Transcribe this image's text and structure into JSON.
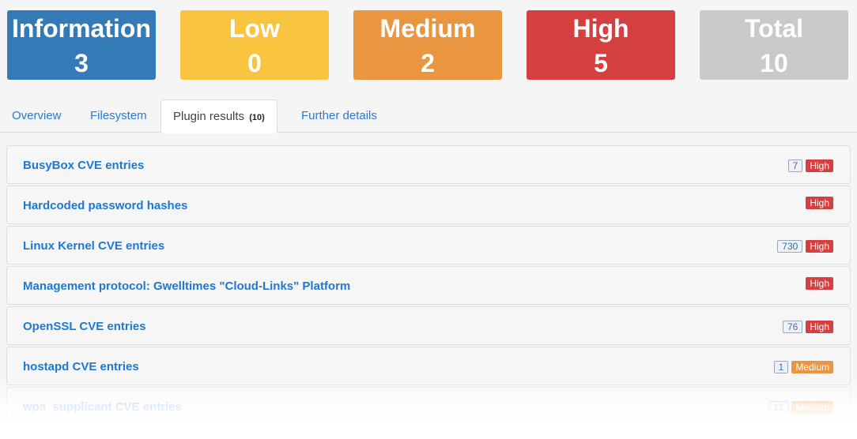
{
  "summary": [
    {
      "label": "Information",
      "count": "3",
      "color": "#337ab7"
    },
    {
      "label": "Low",
      "count": "0",
      "color": "#f9c440"
    },
    {
      "label": "Medium",
      "count": "2",
      "color": "#ea9641"
    },
    {
      "label": "High",
      "count": "5",
      "color": "#d43f3f"
    },
    {
      "label": "Total",
      "count": "10",
      "color": "#c9c9c9"
    }
  ],
  "tabs": [
    {
      "label": "Overview"
    },
    {
      "label": "Filesystem"
    },
    {
      "label": "Plugin results",
      "count": "(10)",
      "active": true
    },
    {
      "label": "Further details"
    }
  ],
  "severity_colors": {
    "High": "#d43f3f",
    "Medium": "#ea9641"
  },
  "results": [
    {
      "title": "BusyBox CVE entries",
      "count": "7",
      "severity": "High"
    },
    {
      "title": "Hardcoded password hashes",
      "count": "",
      "severity": "High"
    },
    {
      "title": "Linux Kernel CVE entries",
      "count": "730",
      "severity": "High"
    },
    {
      "title": "Management protocol: Gwelltimes \"Cloud-Links\" Platform",
      "count": "",
      "severity": "High"
    },
    {
      "title": "OpenSSL CVE entries",
      "count": "76",
      "severity": "High"
    },
    {
      "title": "hostapd CVE entries",
      "count": "1",
      "severity": "Medium"
    },
    {
      "title": "wpa_supplicant CVE entries",
      "count": "12",
      "severity": "Medium"
    }
  ]
}
